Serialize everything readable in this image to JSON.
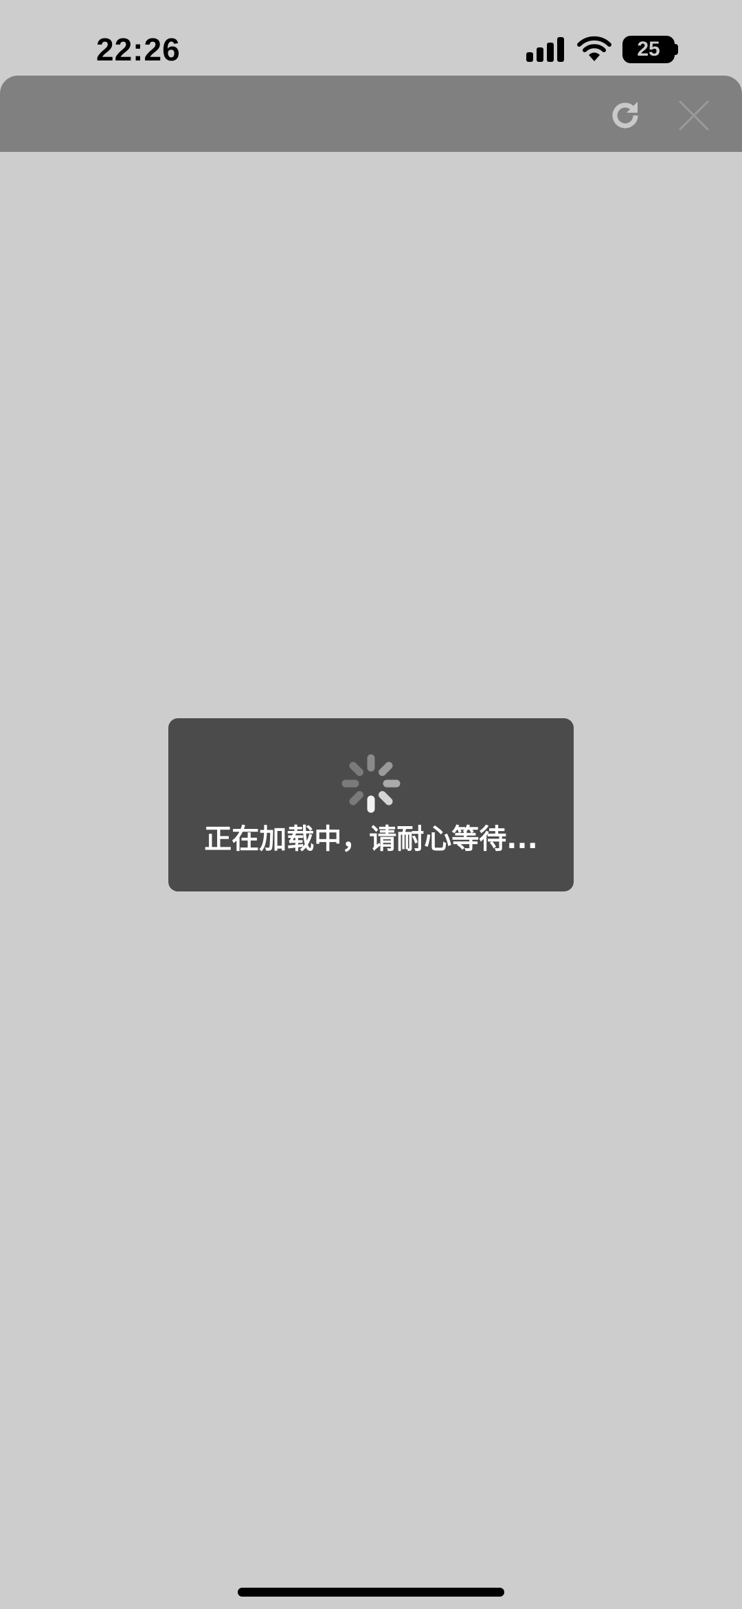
{
  "status_bar": {
    "time": "22:26",
    "battery_level": "25",
    "icons": [
      "signal-icon",
      "wifi-icon",
      "battery-icon"
    ]
  },
  "header": {
    "actions": [
      {
        "icon": "refresh-icon"
      },
      {
        "icon": "close-icon"
      }
    ]
  },
  "loading_toast": {
    "icon": "spinner-icon",
    "message": "正在加载中，请耐心等待..."
  },
  "colors": {
    "page_background": "#cdcdcd",
    "header_background": "#808080",
    "toast_background": "#4b4b4b",
    "toast_text": "#ffffff"
  }
}
